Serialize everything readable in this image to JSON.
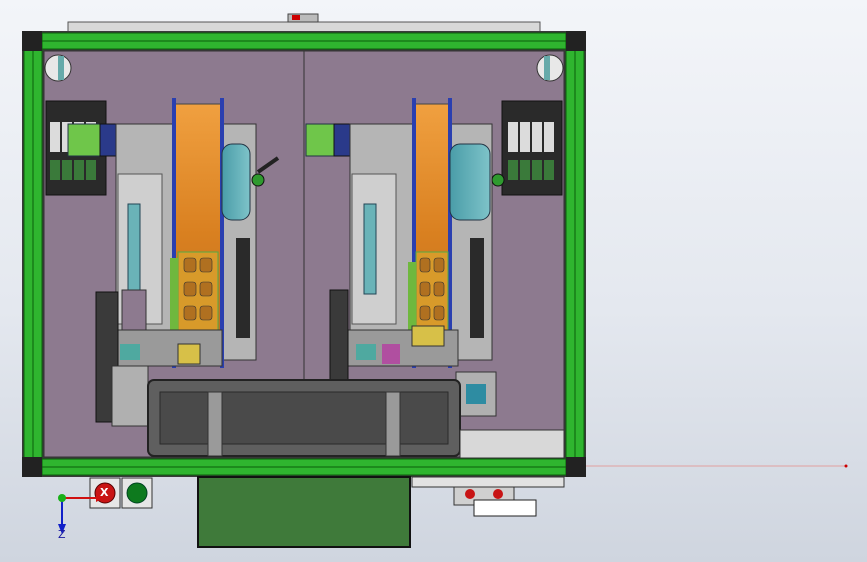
{
  "viewport": {
    "axis_triad": {
      "z_label": "Z"
    },
    "controls": {
      "stop_button": {
        "glyph": "X",
        "icon": "red-stop-icon",
        "color": "#c81414"
      },
      "start_button": {
        "icon": "green-start-icon",
        "color": "#0e7a1e"
      }
    },
    "colors": {
      "frame_green": "#2fb52f",
      "panel_purple": "#8d7a8f",
      "reel_orange": "#e48a28",
      "body_green": "#3f7a3a",
      "tray_grey": "#5f5f5f"
    }
  }
}
